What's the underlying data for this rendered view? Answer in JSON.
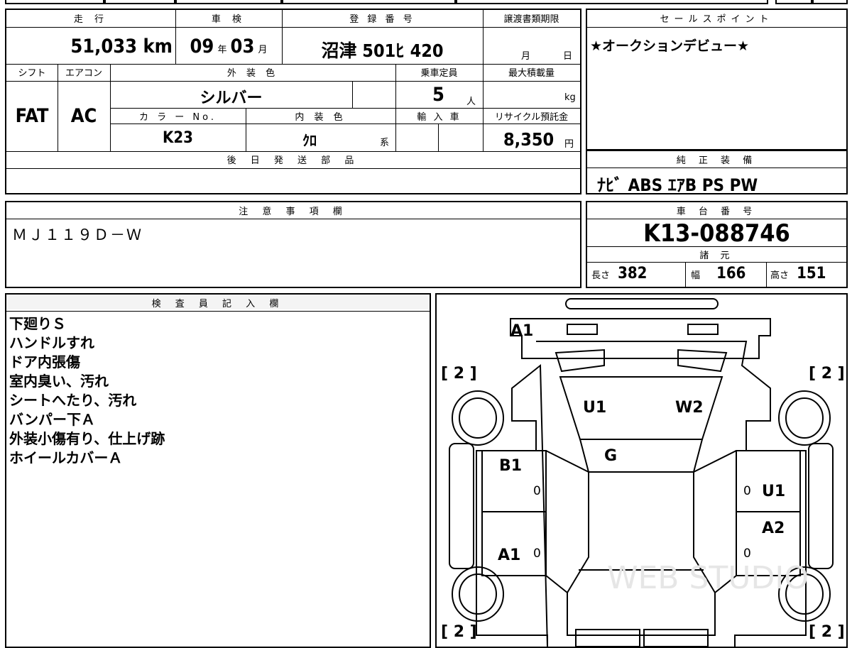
{
  "vehicle": {
    "mileage_header": "走 行",
    "mileage": "51,033 km",
    "inspection_header": "車 検",
    "inspection_year": "09",
    "inspection_year_unit": "年",
    "inspection_month": "03",
    "inspection_month_unit": "月",
    "registration_header": "登 録 番 号",
    "registration": "沼津 501ﾋ 420",
    "transfer_header": "譲渡書類期限",
    "transfer_month_unit": "月",
    "transfer_day_unit": "日",
    "shift_header": "シフト",
    "shift": "FAT",
    "ac_header": "エアコン",
    "ac": "AC",
    "exterior_header": "外 装 色",
    "exterior_color": "シルバー",
    "capacity_header": "乗車定員",
    "capacity": "5",
    "capacity_unit": "人",
    "max_load_header": "最大積載量",
    "max_load_unit": "kg",
    "color_no_header": "カ ラ ー No.",
    "color_no": "K23",
    "interior_header": "内 装 色",
    "interior_color": "ｸﾛ",
    "interior_unit": "系",
    "import_header": "輸 入 車",
    "recycle_header": "リサイクル預託金",
    "recycle": "8,350",
    "recycle_unit": "円",
    "later_parts_header": "後 日 発 送 部 品"
  },
  "sales_point": {
    "header": "セールスポイント",
    "text": "★オークションデビュー★"
  },
  "equipment": {
    "header": "純 正 装 備",
    "text": "ﾅﾋﾞ ABS ｴｱB PS PW"
  },
  "notes": {
    "header": "注 意 事 項 欄",
    "text": "ＭＪ１１９Ｄ－Ｗ"
  },
  "chassis": {
    "header": "車 台 番 号",
    "number": "K13-088746",
    "spec_header": "諸 元",
    "length_label": "長さ",
    "length": "382",
    "width_label": "幅",
    "width": "166",
    "height_label": "高さ",
    "height": "151"
  },
  "inspector": {
    "header": "検 査 員 記 入 欄",
    "lines": [
      "下廻りＳ",
      "ハンドルすれ",
      "ドア内張傷",
      "室内臭い、汚れ",
      "シートへたり、汚れ",
      "バンパー下Ａ",
      "外装小傷有り、仕上げ跡",
      "ホイールカバーＡ"
    ]
  },
  "diagram": {
    "tire_fl": "[ 2 ]",
    "tire_fr": "[ 2 ]",
    "tire_rl": "[ 2 ]",
    "tire_rr": "[ 2 ]",
    "front_bumper": "A1",
    "windshield_left": "U1",
    "windshield_right": "W2",
    "hood": "G",
    "left_front_door": "B1",
    "left_front_door_val": "0",
    "right_front_door": "U1",
    "right_front_door_val": "0",
    "left_rear_door": "A1",
    "left_rear_door_val": "0",
    "right_rear_door": "A2",
    "right_rear_door_val": "0",
    "watermark": "WEB STUDIO"
  }
}
